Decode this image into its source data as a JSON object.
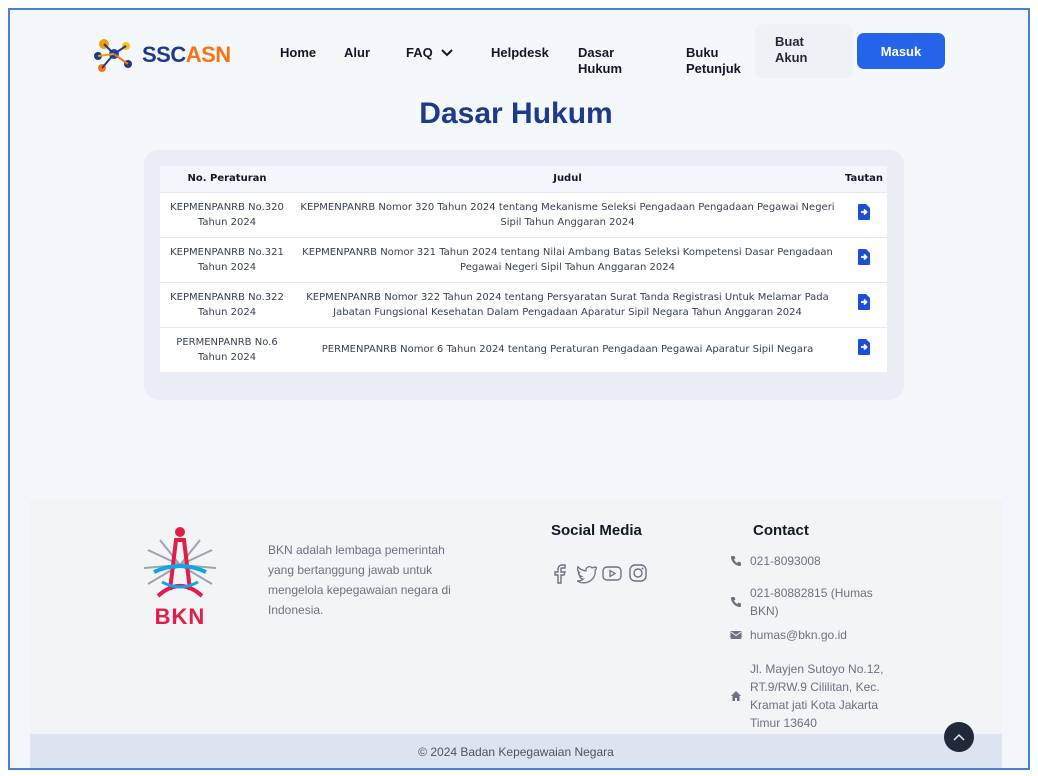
{
  "header": {
    "logo_text_a": "SSC",
    "logo_text_b": "ASN",
    "nav": [
      {
        "label": "Home"
      },
      {
        "label": "Alur"
      },
      {
        "label": "FAQ"
      },
      {
        "label": "Helpdesk"
      },
      {
        "label": "Dasar\nHukum"
      },
      {
        "label": "Buku\nPetunjuk"
      }
    ],
    "buat_akun": "Buat\nAkun",
    "masuk": "Masuk"
  },
  "page_title": "Dasar Hukum",
  "table": {
    "headers": {
      "no": "No. Peraturan",
      "judul": "Judul",
      "tautan": "Tautan"
    },
    "rows": [
      {
        "no": "KEPMENPANRB No.320 Tahun 2024",
        "judul": "KEPMENPANRB Nomor 320 Tahun 2024 tentang Mekanisme Seleksi Pengadaan Pengadaan Pegawai Negeri Sipil Tahun Anggaran 2024"
      },
      {
        "no": "KEPMENPANRB No.321 Tahun 2024",
        "judul": "KEPMENPANRB Nomor 321 Tahun 2024 tentang Nilai Ambang Batas Seleksi Kompetensi Dasar Pengadaan Pegawai Negeri Sipil Tahun Anggaran 2024"
      },
      {
        "no": "KEPMENPANRB No.322 Tahun 2024",
        "judul": "KEPMENPANRB Nomor 322 Tahun 2024 tentang Persyaratan Surat Tanda Registrasi Untuk Melamar Pada Jabatan Fungsional Kesehatan Dalam Pengadaan Aparatur Sipil Negara Tahun Anggaran 2024"
      },
      {
        "no": "PERMENPANRB No.6 Tahun 2024",
        "judul": "PERMENPANRB Nomor 6 Tahun 2024 tentang Peraturan Pengadaan Pegawai Aparatur Sipil Negara"
      }
    ]
  },
  "footer": {
    "bkn_label": "BKN",
    "about": "BKN adalah lembaga pemerintah yang bertanggung jawab untuk mengelola kepegawaian negara di Indonesia.",
    "social_title": "Social Media",
    "social_icons": [
      "facebook-icon",
      "twitter-icon",
      "youtube-icon",
      "instagram-icon"
    ],
    "contact_title": "Contact",
    "phone1": "021-8093008",
    "phone2": "021-80882815 (Humas BKN)",
    "email": "humas@bkn.go.id",
    "address": "Jl. Mayjen Sutoyo No.12, RT.9/RW.9 Cililitan, Kec. Kramat jati Kota Jakarta Timur 13640",
    "copyright": "© 2024  Badan Kepegawaian Negara"
  },
  "colors": {
    "accent": "#2563eb",
    "title": "#1e3a8a",
    "brand_red": "#e11d48"
  }
}
